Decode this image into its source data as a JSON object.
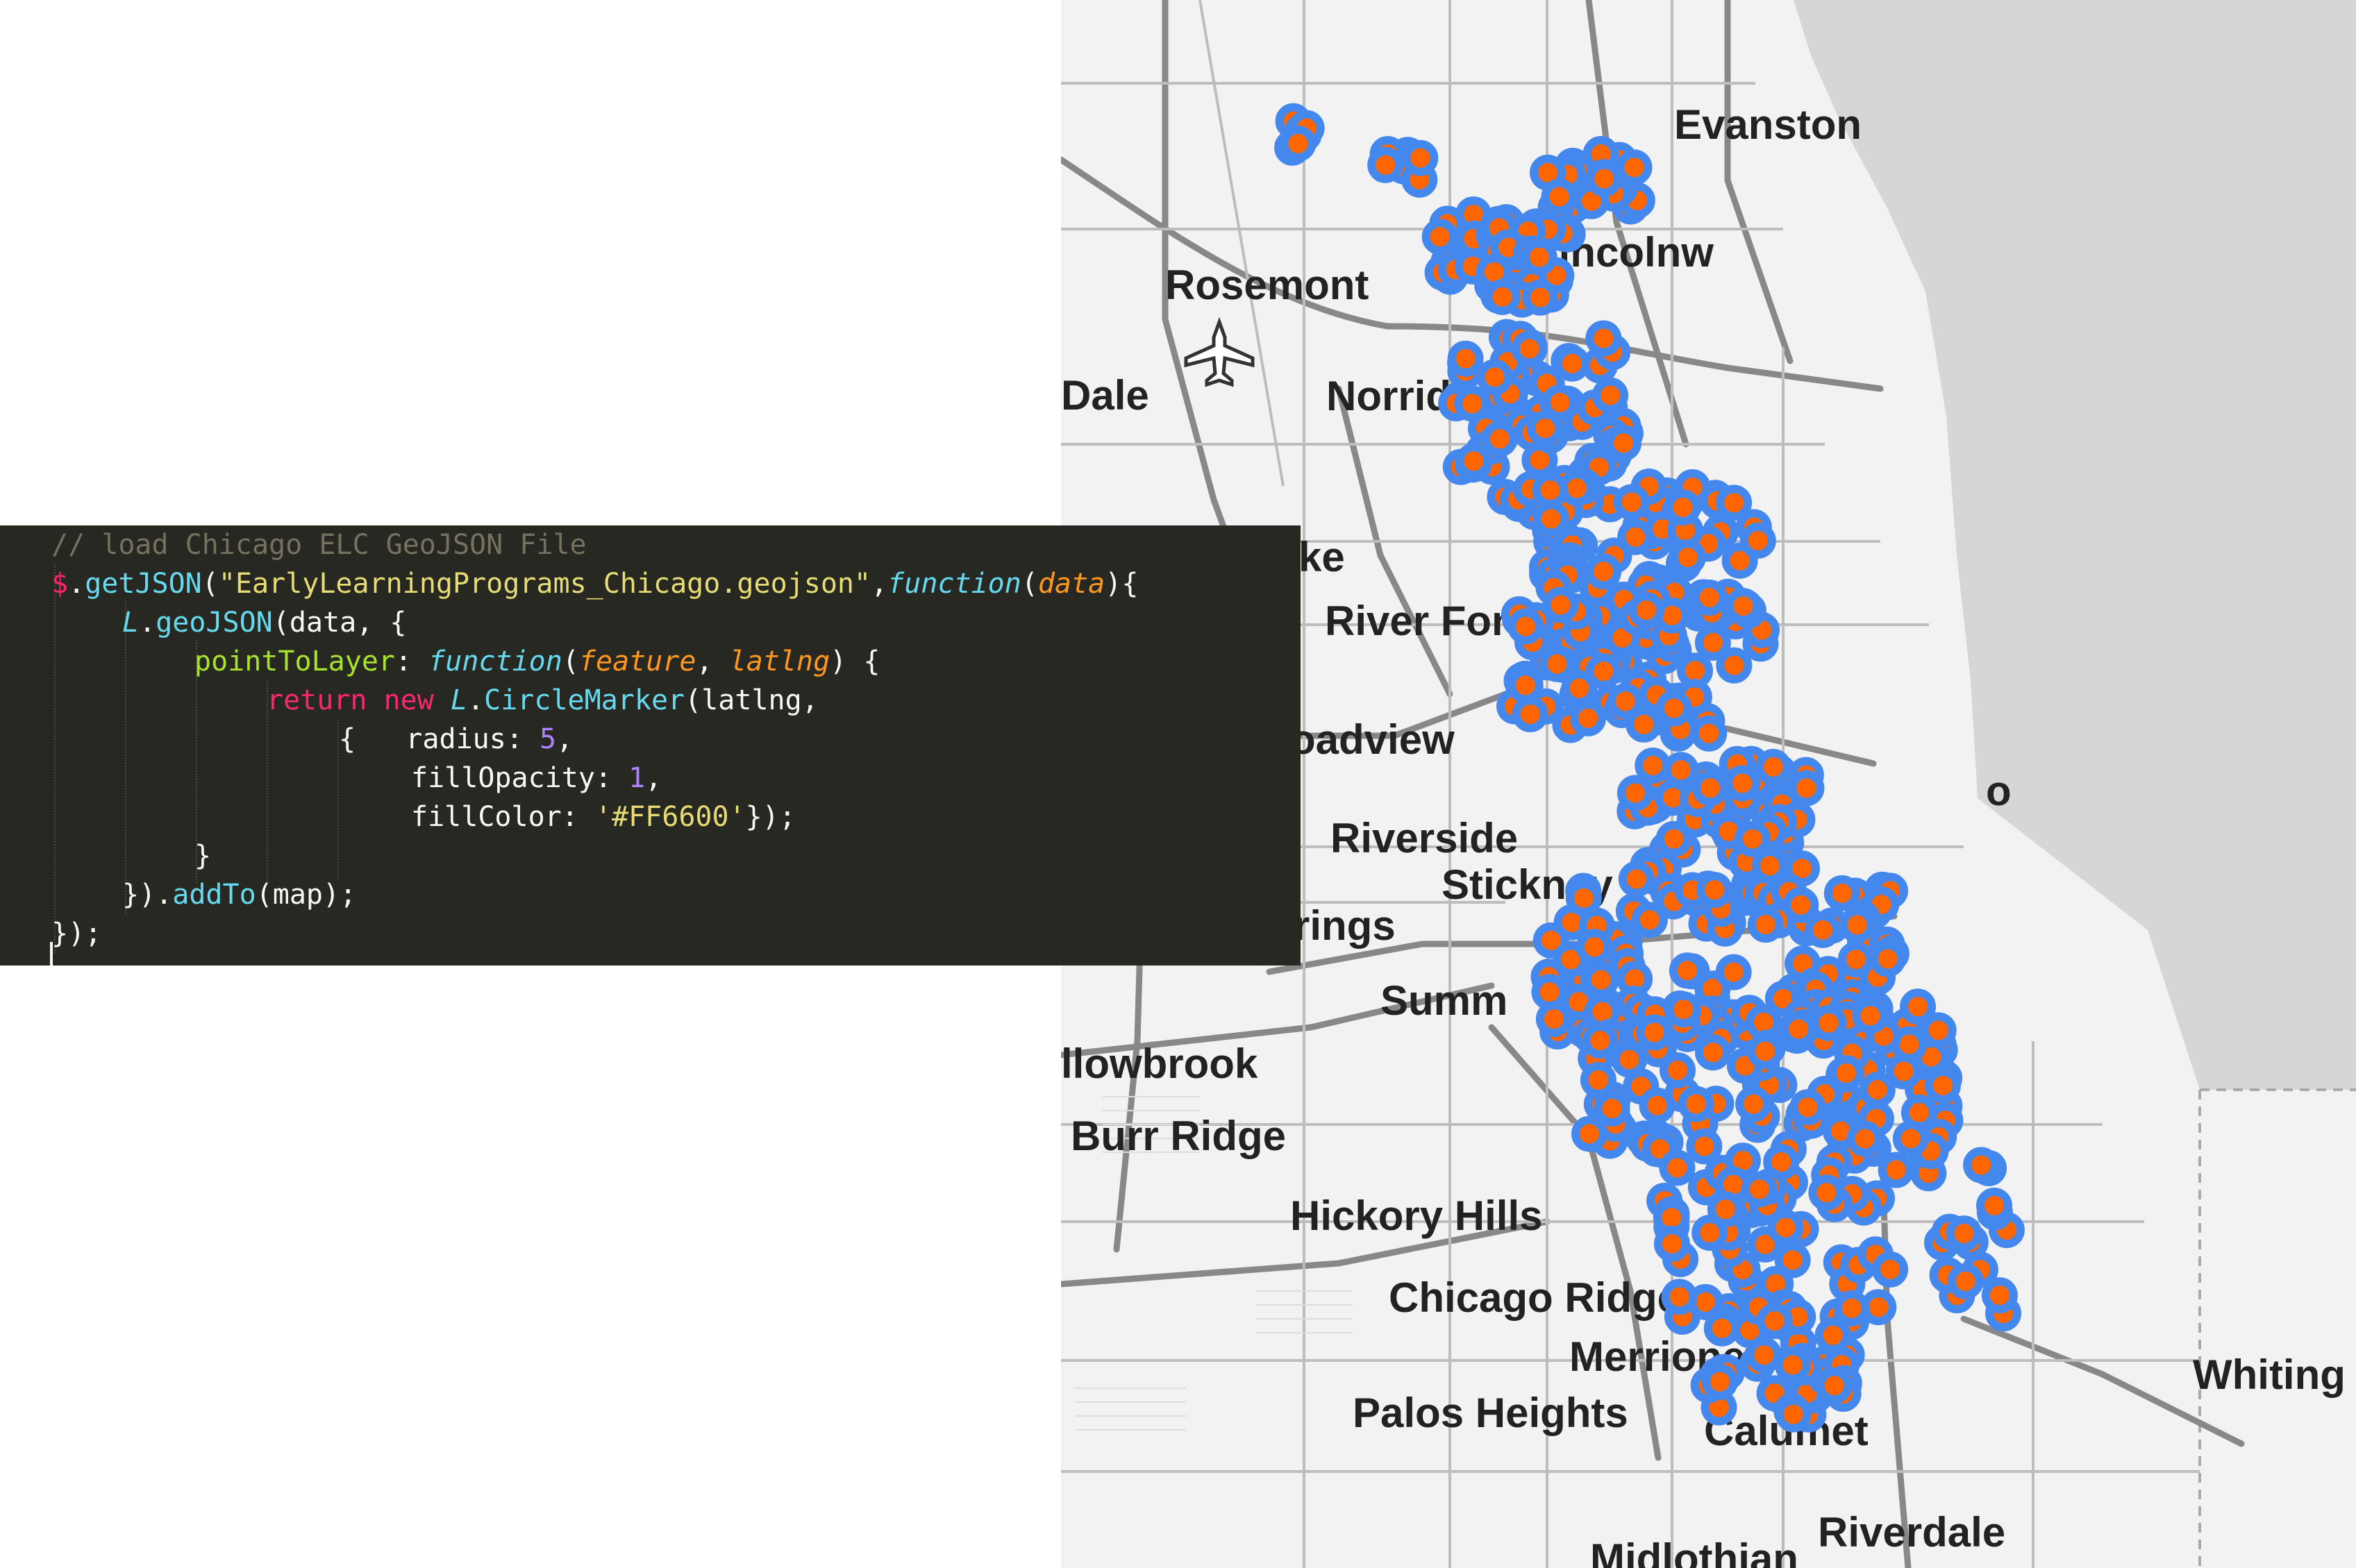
{
  "editor": {
    "lines": [
      {
        "indent": 0,
        "tokens": [
          {
            "t": "// load Chicago ELC GeoJSON File",
            "c": "c-comment"
          }
        ]
      },
      {
        "indent": 0,
        "tokens": [
          {
            "t": "$",
            "c": "c-dollar"
          },
          {
            "t": ".",
            "c": "c-plain"
          },
          {
            "t": "getJSON",
            "c": "c-fn"
          },
          {
            "t": "(",
            "c": "c-plain"
          },
          {
            "t": "\"EarlyLearningPrograms_Chicago.geojson\"",
            "c": "c-str"
          },
          {
            "t": ",",
            "c": "c-plain"
          },
          {
            "t": "function",
            "c": "c-kw-it"
          },
          {
            "t": "(",
            "c": "c-plain"
          },
          {
            "t": "data",
            "c": "c-param"
          },
          {
            "t": "){",
            "c": "c-plain"
          }
        ]
      },
      {
        "indent": 1,
        "tokens": [
          {
            "t": "L",
            "c": "c-obj"
          },
          {
            "t": ".",
            "c": "c-plain"
          },
          {
            "t": "geoJSON",
            "c": "c-fn"
          },
          {
            "t": "(data, {",
            "c": "c-plain"
          }
        ]
      },
      {
        "indent": 2,
        "tokens": [
          {
            "t": "pointToLayer",
            "c": "c-key"
          },
          {
            "t": ": ",
            "c": "c-plain"
          },
          {
            "t": "function",
            "c": "c-kw-it"
          },
          {
            "t": "(",
            "c": "c-plain"
          },
          {
            "t": "feature",
            "c": "c-param"
          },
          {
            "t": ", ",
            "c": "c-plain"
          },
          {
            "t": "latlng",
            "c": "c-param"
          },
          {
            "t": ") {",
            "c": "c-plain"
          }
        ]
      },
      {
        "indent": 3,
        "tokens": [
          {
            "t": "return",
            "c": "c-kw"
          },
          {
            "t": " ",
            "c": "c-plain"
          },
          {
            "t": "new",
            "c": "c-kw"
          },
          {
            "t": " ",
            "c": "c-plain"
          },
          {
            "t": "L",
            "c": "c-obj"
          },
          {
            "t": ".",
            "c": "c-plain"
          },
          {
            "t": "CircleMarker",
            "c": "c-fn"
          },
          {
            "t": "(latlng,",
            "c": "c-plain"
          }
        ]
      },
      {
        "indent": 4,
        "tokens": [
          {
            "t": "{   radius: ",
            "c": "c-plain"
          },
          {
            "t": "5",
            "c": "c-num"
          },
          {
            "t": ",",
            "c": "c-plain"
          }
        ]
      },
      {
        "indent": 5,
        "tokens": [
          {
            "t": "fillOpacity: ",
            "c": "c-plain"
          },
          {
            "t": "1",
            "c": "c-num"
          },
          {
            "t": ",",
            "c": "c-plain"
          }
        ]
      },
      {
        "indent": 5,
        "tokens": [
          {
            "t": "fillColor: ",
            "c": "c-plain"
          },
          {
            "t": "'#FF6600'",
            "c": "c-str"
          },
          {
            "t": "});",
            "c": "c-plain"
          }
        ]
      },
      {
        "indent": 2,
        "tokens": [
          {
            "t": "}",
            "c": "c-plain"
          }
        ]
      },
      {
        "indent": 1,
        "tokens": [
          {
            "t": "}).",
            "c": "c-plain"
          },
          {
            "t": "addTo",
            "c": "c-fn"
          },
          {
            "t": "(map);",
            "c": "c-plain"
          }
        ]
      },
      {
        "indent": 0,
        "tokens": [
          {
            "t": "});",
            "c": "c-plain"
          }
        ]
      }
    ]
  },
  "map": {
    "place_labels": [
      "Evanston",
      "Lincolnw",
      "Rosemont",
      "Dale",
      "Norridge",
      "ke",
      "River Fore",
      "oadview",
      "Riverside",
      "Stickney",
      "rings",
      "Summ",
      "llowbrook",
      "Burr Ridge",
      "Hickory Hills",
      "Chicago Ridge",
      "Merrionette",
      "Palos Heights",
      "Calumet",
      "Whiting",
      "Riverdale",
      "Midlothian",
      "o"
    ],
    "airport_icon": "airplane-icon",
    "marker_style": {
      "stroke": "#4488ee",
      "fill": "#ff6600"
    }
  }
}
